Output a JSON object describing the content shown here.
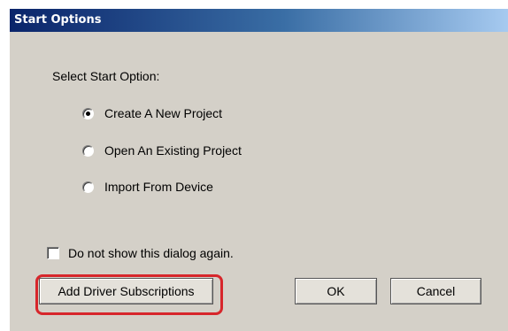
{
  "dialog": {
    "title": "Start Options",
    "prompt": "Select Start Option:",
    "options": [
      {
        "label": "Create A New Project",
        "checked": true
      },
      {
        "label": "Open An Existing Project",
        "checked": false
      },
      {
        "label": "Import From Device",
        "checked": false
      }
    ],
    "checkbox_label": "Do not show this dialog again.",
    "checkbox_checked": false,
    "buttons": {
      "add_driver": "Add Driver Subscriptions",
      "ok": "OK",
      "cancel": "Cancel"
    }
  },
  "annotation": {
    "highlight_color": "#d7262b",
    "highlighted_element": "add-driver-subscriptions-button"
  }
}
